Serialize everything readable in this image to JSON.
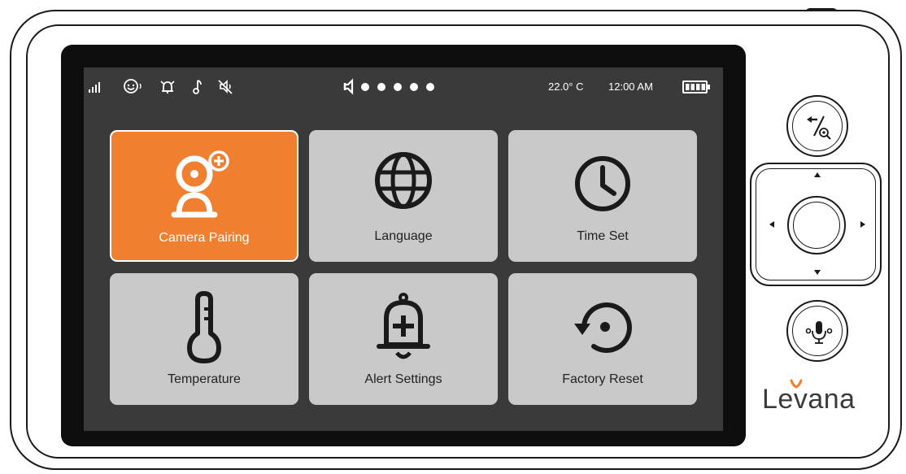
{
  "status_bar": {
    "icons": [
      "signal-icon",
      "baby-face-icon",
      "alarm-icon",
      "music-note-icon",
      "mute-icon",
      "speaker-icon"
    ],
    "volume_level": 5,
    "volume_max": 5,
    "temperature": "22.0° C",
    "time": "12:00 AM",
    "battery_level": 1.0
  },
  "menu": {
    "selected_index": 0,
    "tiles": [
      {
        "label": "Camera Pairing",
        "icon": "camera-add-icon"
      },
      {
        "label": "Language",
        "icon": "globe-icon"
      },
      {
        "label": "Time Set",
        "icon": "clock-icon"
      },
      {
        "label": "Temperature",
        "icon": "thermometer-icon"
      },
      {
        "label": "Alert Settings",
        "icon": "bell-plus-icon"
      },
      {
        "label": "Factory Reset",
        "icon": "reset-icon"
      }
    ]
  },
  "controls": {
    "buttons": [
      "back-zoom-icon",
      "dpad",
      "mic-icon"
    ]
  },
  "brand": {
    "logo_text": "Levana",
    "accent_color": "#f08030",
    "tile_color": "#c9c9c9",
    "screen_color": "#3a3a3a"
  }
}
